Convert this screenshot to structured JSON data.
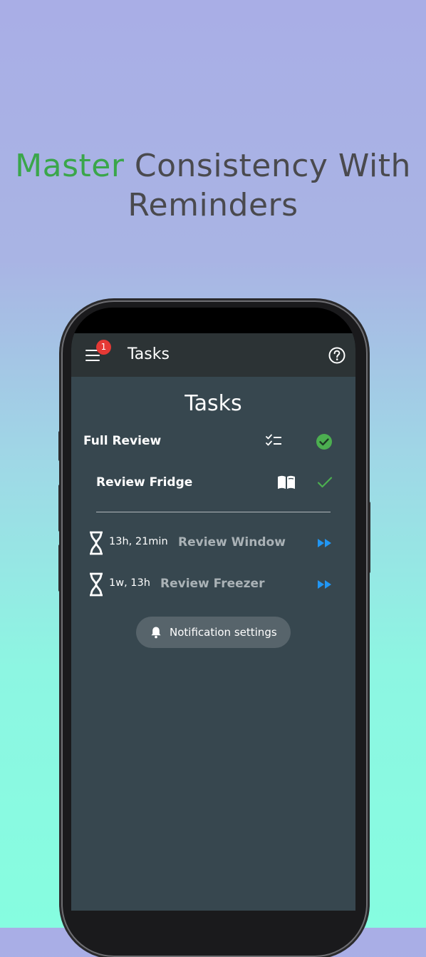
{
  "promo": {
    "headline_accent": "Master",
    "headline_rest": "Consistency With",
    "headline_line2": "Reminders",
    "accent_color": "#3aa64a"
  },
  "appbar": {
    "title": "Tasks",
    "menu_icon": "menu-icon",
    "badge_count": "1",
    "help_icon": "help-circle-icon"
  },
  "page": {
    "title": "Tasks"
  },
  "tasks": [
    {
      "label": "Full Review",
      "type_icon": "checklist-icon",
      "status_icon": "check-circle-icon"
    },
    {
      "label": "Review Fridge",
      "type_icon": "open-book-icon",
      "status_icon": "check-icon"
    }
  ],
  "scheduled": [
    {
      "time": "13h, 21min",
      "label": "Review Window",
      "icon": "hourglass-icon",
      "action_icon": "fast-forward-icon"
    },
    {
      "time": "1w, 13h",
      "label": "Review Freezer",
      "icon": "hourglass-icon",
      "action_icon": "fast-forward-icon"
    }
  ],
  "notification_button": {
    "label": "Notification settings",
    "icon": "bell-icon"
  },
  "colors": {
    "appbar": "#2c3335",
    "content": "#37474f",
    "success": "#4caf50",
    "action": "#2196f3",
    "badge": "#e53935"
  }
}
